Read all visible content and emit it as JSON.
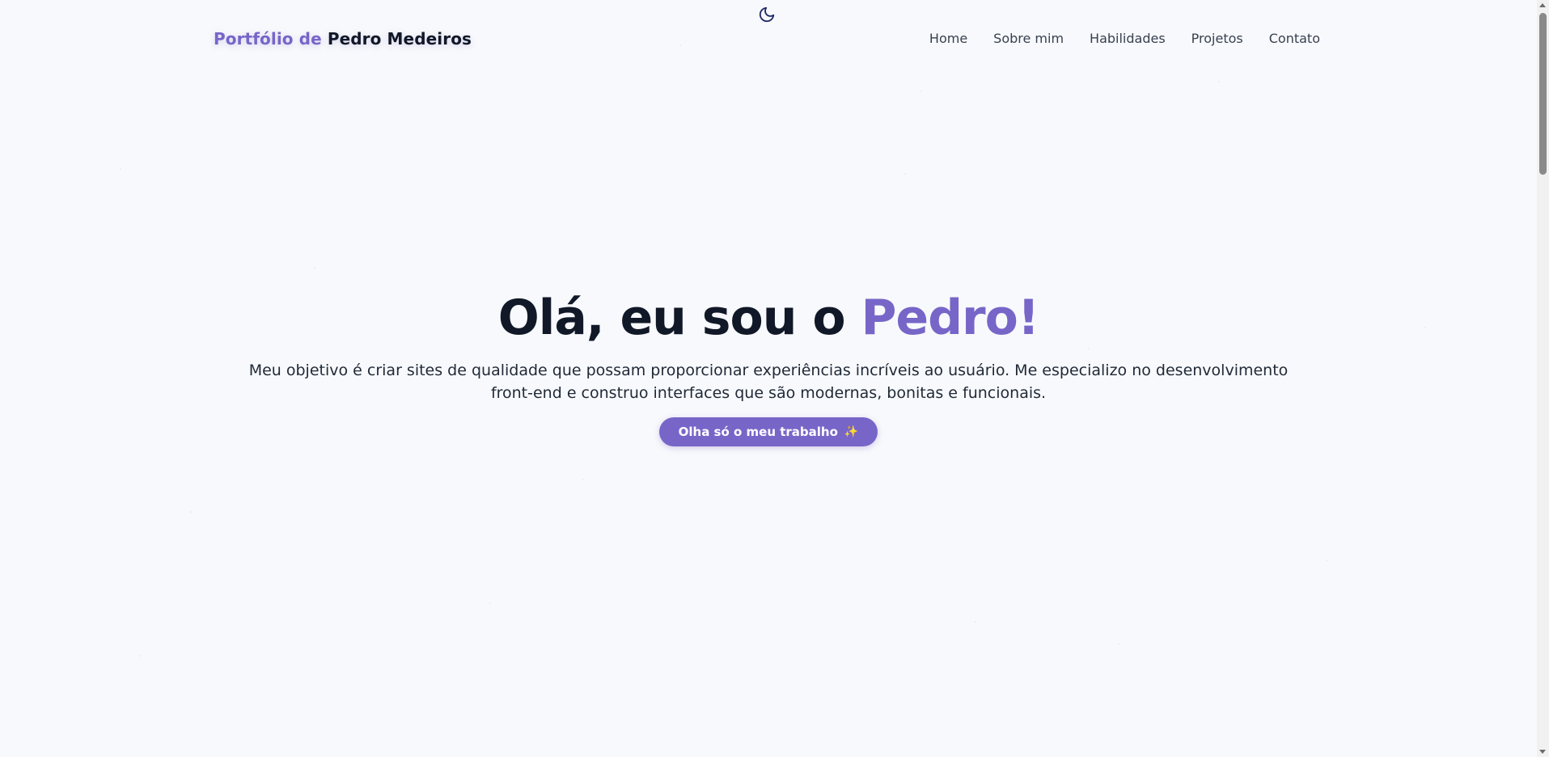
{
  "header": {
    "brand_prefix": "Portfólio de",
    "brand_name": "Pedro Medeiros",
    "theme_icon": "moon-icon",
    "nav": [
      {
        "label": "Home"
      },
      {
        "label": "Sobre mim"
      },
      {
        "label": "Habilidades"
      },
      {
        "label": "Projetos"
      },
      {
        "label": "Contato"
      }
    ]
  },
  "hero": {
    "title_prefix": "Olá, eu sou o",
    "title_name": "Pedro!",
    "subtitle": "Meu objetivo é criar sites de qualidade que possam proporcionar experiências incríveis ao usuário. Me especializo no desenvolvimento front-end e construo interfaces que são modernas, bonitas e funcionais.",
    "cta_label": "Olha só o meu trabalho",
    "cta_icon": "sparkles-icon",
    "cta_emoji": "✨"
  },
  "colors": {
    "accent": "#7766c8",
    "text_dark": "#111827",
    "background": "#f8f9fc"
  }
}
